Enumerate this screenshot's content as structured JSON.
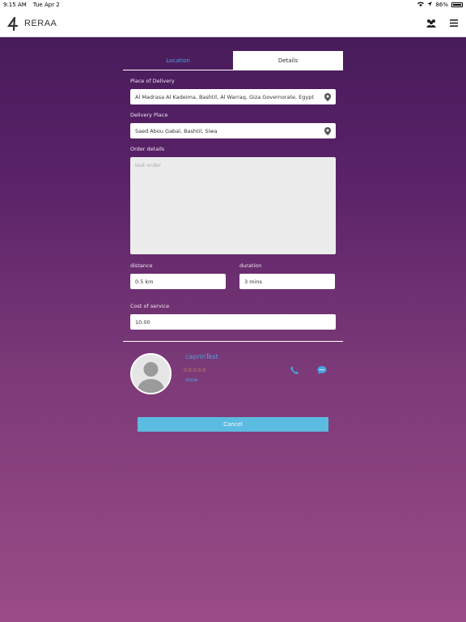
{
  "status_bar": {
    "time": "9:15 AM",
    "date": "Tue Apr 2",
    "battery": "86%"
  },
  "header": {
    "brand": "RERAA"
  },
  "tabs": [
    {
      "label": "Location"
    },
    {
      "label": "Details"
    }
  ],
  "form": {
    "place_of_delivery_label": "Place of Delivery",
    "place_of_delivery_value": "Al Madrasa Al Kadeima, Bashtil, Al Warraq, Giza Governorate, Egypt",
    "delivery_place_label": "Delivery Place",
    "delivery_place_value": "Saed Abou Gabal, Bashtil, Siwa",
    "order_details_label": "Order details",
    "order_details_value": "test order",
    "distance_label": "distance",
    "distance_value": "0.5 km",
    "duration_label": "duration",
    "duration_value": "3 mins",
    "cost_label": "Cost of service",
    "cost_value": "10.00"
  },
  "driver": {
    "name": "caprinTest",
    "rating": "☆☆☆☆☆",
    "status": "show"
  },
  "actions": {
    "cancel_label": "Cancel"
  },
  "icons": {
    "logo": "logo-icon",
    "group": "group-icon",
    "menu": "menu-icon",
    "location": "location-pin-icon",
    "phone": "phone-icon",
    "chat": "chat-icon"
  },
  "colors": {
    "accent": "#4aa3df",
    "button": "#5cbbe0",
    "star": "#f2c14e"
  }
}
